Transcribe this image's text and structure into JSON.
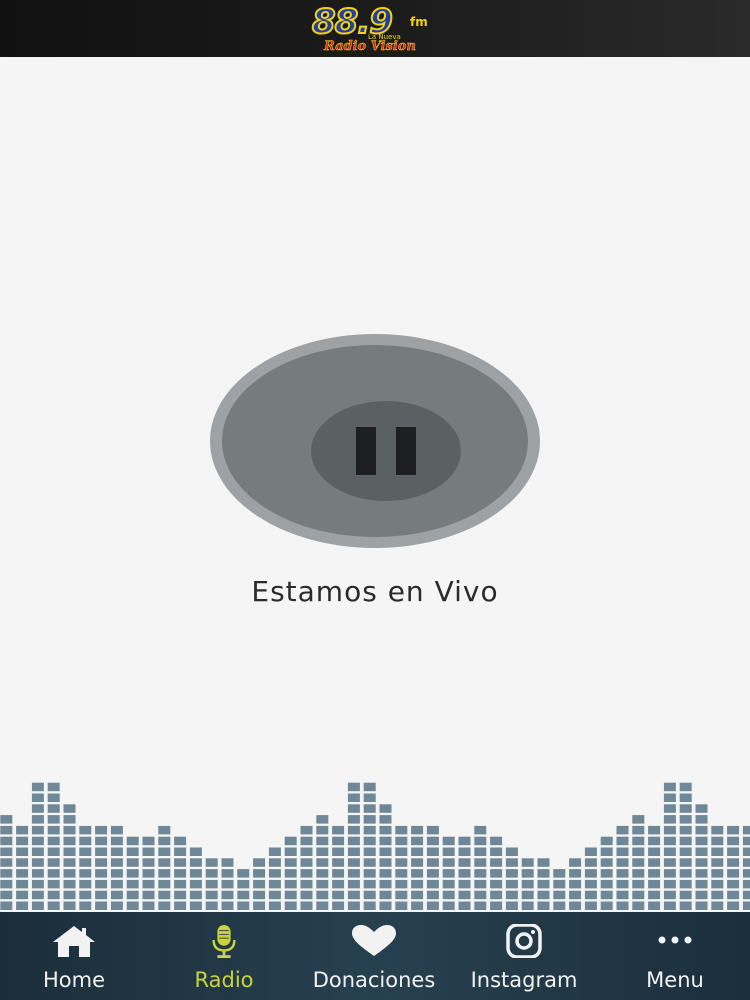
{
  "header": {
    "logo_main": "88.9",
    "logo_fm": "fm",
    "logo_tag": "La Nueva",
    "logo_sub": "Radio Vision"
  },
  "player": {
    "state": "playing",
    "status_text": "Estamos en Vivo"
  },
  "equalizer": {
    "bar_color": "#6f8898",
    "levels": [
      5,
      4,
      8,
      8,
      6,
      4,
      4,
      4,
      3,
      3,
      4,
      3,
      2,
      1,
      1,
      0,
      1,
      2,
      3,
      4,
      5,
      4,
      8,
      8,
      6,
      4,
      4,
      4,
      3,
      3,
      4,
      3,
      2,
      1,
      1,
      0,
      1,
      2,
      3,
      4,
      5,
      4,
      8,
      8,
      6,
      4,
      4,
      4,
      3
    ]
  },
  "nav": {
    "active_color": "#c9d43a",
    "items": [
      {
        "label": "Home",
        "icon": "home-icon",
        "active": false
      },
      {
        "label": "Radio",
        "icon": "microphone-icon",
        "active": true
      },
      {
        "label": "Donaciones",
        "icon": "heart-icon",
        "active": false
      },
      {
        "label": "Instagram",
        "icon": "instagram-icon",
        "active": false
      },
      {
        "label": "Menu",
        "icon": "more-dots-icon",
        "active": false
      }
    ]
  }
}
